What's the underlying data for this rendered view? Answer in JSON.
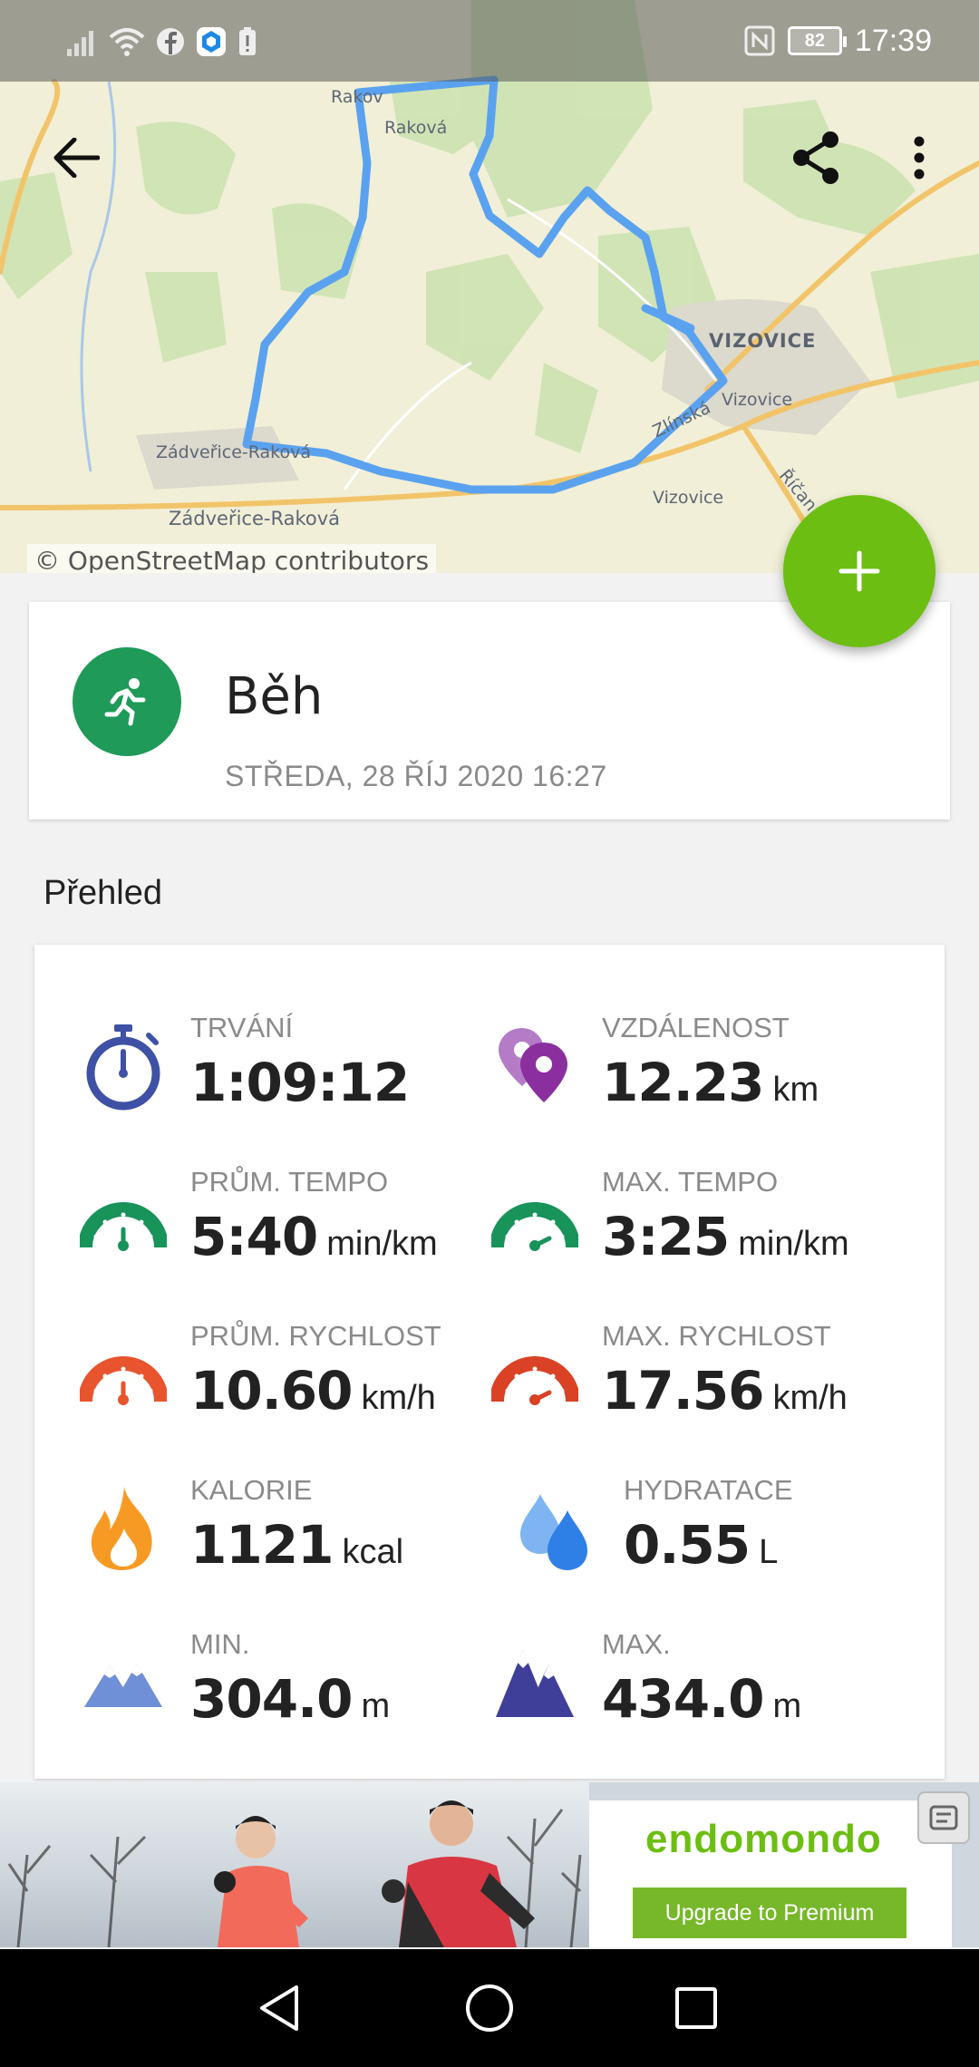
{
  "status_bar": {
    "time": "17:39",
    "battery": "82"
  },
  "map": {
    "labels": {
      "rakova_top": "Rakov",
      "rakova": "Raková",
      "vizovice_town": "VIZOVICE",
      "vizovice_road": "Vizovice",
      "vizovice_bottom": "Vizovice",
      "zlinska": "Zlínská",
      "ricanka": "Říčan",
      "zadverice_1": "Zádveřice-Raková",
      "zadverice_2": "Zádveřice-Raková"
    },
    "attribution": "© OpenStreetMap contributors",
    "route_color": "#5aa2f0"
  },
  "toolbar": {
    "back_icon": "arrow-back-icon",
    "share_icon": "share-icon",
    "menu_icon": "more-vert-icon"
  },
  "fab": {
    "icon": "plus-icon",
    "color": "#6cbe12"
  },
  "activity": {
    "title": "Běh",
    "date": "STŘEDA, 28 ŘÍJ 2020 16:27",
    "icon": "running-person-icon",
    "color": "#1f9a59"
  },
  "overview": {
    "title": "Přehled",
    "stats": [
      {
        "label": "TRVÁNÍ",
        "value": "1:09:12",
        "unit": "",
        "icon": "stopwatch-icon"
      },
      {
        "label": "VZDÁLENOST",
        "value": "12.23",
        "unit": "km",
        "icon": "map-pins-icon"
      },
      {
        "label": "PRŮM. TEMPO",
        "value": "5:40",
        "unit": "min/km",
        "icon": "speedometer-green-icon"
      },
      {
        "label": "MAX. TEMPO",
        "value": "3:25",
        "unit": "min/km",
        "icon": "speedometer-green-fast-icon"
      },
      {
        "label": "PRŮM. RYCHLOST",
        "value": "10.60",
        "unit": "km/h",
        "icon": "speedometer-red-icon"
      },
      {
        "label": "MAX. RYCHLOST",
        "value": "17.56",
        "unit": "km/h",
        "icon": "speedometer-red-fast-icon"
      },
      {
        "label": "KALORIE",
        "value": "1121",
        "unit": "kcal",
        "icon": "flame-icon"
      },
      {
        "label": "HYDRATACE",
        "value": "0.55",
        "unit": "L",
        "icon": "water-drops-icon"
      },
      {
        "label": "MIN.",
        "value": "304.0",
        "unit": "m",
        "icon": "mountain-low-icon"
      },
      {
        "label": "MAX.",
        "value": "434.0",
        "unit": "m",
        "icon": "mountain-high-icon"
      }
    ]
  },
  "ad": {
    "brand": "endomondo",
    "cta": "Upgrade to Premium"
  },
  "navbar": {
    "back": "nav-back-icon",
    "home": "nav-home-icon",
    "recents": "nav-recents-icon"
  }
}
